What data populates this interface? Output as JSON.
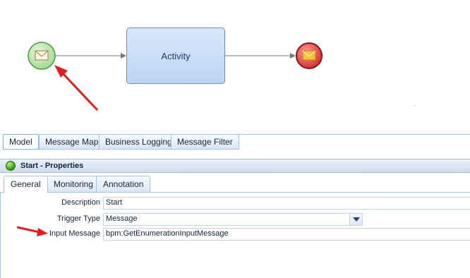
{
  "diagram": {
    "activity_label": "Activity",
    "start_event_icon": "envelope-icon",
    "end_event_icon": "envelope-icon",
    "colors": {
      "start": "#4db84a",
      "end": "#d93232",
      "activity": "#bcd5f4",
      "annotation": "#e02020"
    }
  },
  "model_tabs": [
    {
      "label": "Model"
    },
    {
      "label": "Message Map"
    },
    {
      "label": "Business Logging"
    },
    {
      "label": "Message Filter"
    }
  ],
  "properties": {
    "title": "Start - Properties",
    "tabs": [
      {
        "label": "General"
      },
      {
        "label": "Monitoring"
      },
      {
        "label": "Annotation"
      }
    ],
    "fields": {
      "description": {
        "label": "Description",
        "value": "Start"
      },
      "trigger_type": {
        "label": "Trigger Type",
        "value": "Message"
      },
      "input_message": {
        "label": "Input Message",
        "value": "bpm:GetEnumerationInputMessage"
      }
    }
  }
}
